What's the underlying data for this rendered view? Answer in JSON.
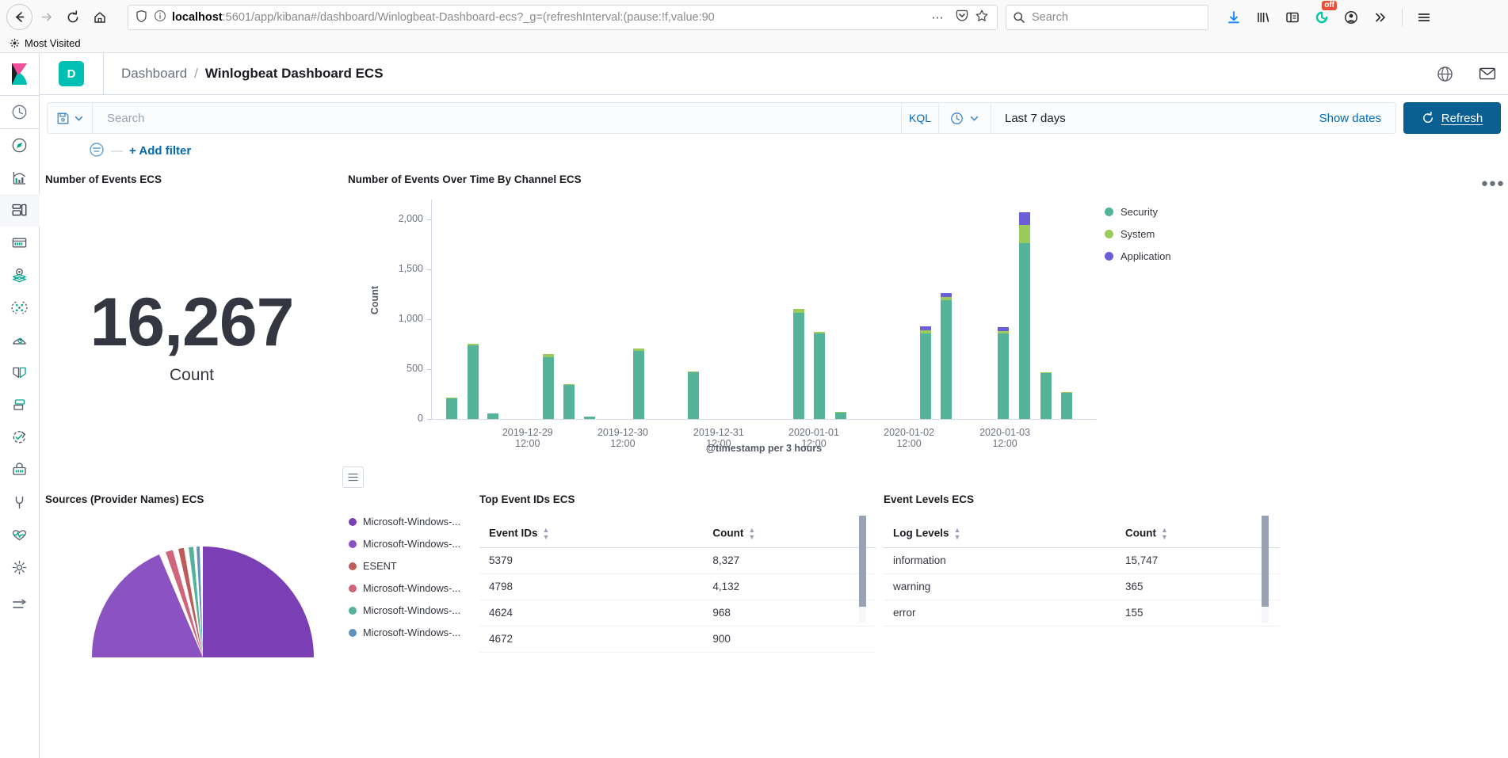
{
  "browser": {
    "url_prefix": "localhost",
    "url_rest": ":5601/app/kibana#/dashboard/Winlogbeat-Dashboard-ecs?_g=(refreshInterval:(pause:!f,value:90",
    "search_placeholder": "Search",
    "bookmark": "Most Visited",
    "icons": {
      "back": "back-arrow-icon",
      "forward": "forward-arrow-icon",
      "reload": "reload-icon",
      "home": "home-icon",
      "shield": "shield-icon",
      "info": "page-info-icon",
      "meatballs": "page-actions-icon",
      "pocket": "pocket-icon",
      "star": "bookmark-star-icon",
      "search": "search-icon",
      "download": "download-icon",
      "library": "library-icon",
      "sidebar": "sidebar-icon",
      "extension_badge": "off",
      "account": "account-icon",
      "overflow": "overflow-chevrons-icon",
      "menu": "hamburger-menu-icon"
    }
  },
  "kibana": {
    "app_badge": "D",
    "breadcrumb_parent": "Dashboard",
    "breadcrumb_separator": "/",
    "breadcrumb_current": "Winlogbeat Dashboard ECS",
    "sidebar_items": [
      {
        "name": "recently-viewed",
        "icon": "clock-icon"
      },
      {
        "name": "discover",
        "icon": "compass-icon"
      },
      {
        "name": "visualize",
        "icon": "bar-chart-icon"
      },
      {
        "name": "dashboard",
        "icon": "dashboard-icon",
        "active": true
      },
      {
        "name": "canvas",
        "icon": "canvas-icon"
      },
      {
        "name": "maps",
        "icon": "map-marker-icon"
      },
      {
        "name": "machine-learning",
        "icon": "machine-learning-icon"
      },
      {
        "name": "infrastructure",
        "icon": "infrastructure-icon"
      },
      {
        "name": "logs",
        "icon": "logs-icon"
      },
      {
        "name": "apm",
        "icon": "apm-icon"
      },
      {
        "name": "uptime",
        "icon": "uptime-icon"
      },
      {
        "name": "siem",
        "icon": "siem-icon"
      },
      {
        "name": "dev-tools",
        "icon": "wrench-icon"
      },
      {
        "name": "monitoring",
        "icon": "heartbeat-icon"
      },
      {
        "name": "management",
        "icon": "gear-icon"
      },
      {
        "name": "collapse-nav",
        "icon": "collapse-arrow-icon"
      }
    ],
    "header_icons": [
      {
        "name": "help",
        "icon": "help-globe-icon"
      },
      {
        "name": "newsfeed",
        "icon": "mail-icon"
      }
    ],
    "query": {
      "save_icon": "save-query-icon",
      "chevron_icon": "chevron-down-icon",
      "placeholder": "Search",
      "language": "KQL",
      "clock_icon": "clock-icon",
      "time_range": "Last 7 days",
      "show_dates": "Show dates",
      "refresh_icon": "refresh-icon",
      "refresh_label": "Refresh"
    },
    "filters": {
      "filter_icon": "filter-options-icon",
      "dash": "—",
      "add_filter": "+ Add filter"
    }
  },
  "panels": {
    "metric": {
      "title": "Number of Events ECS",
      "value": "16,267",
      "label": "Count"
    },
    "histogram": {
      "title": "Number of Events Over Time By Channel ECS",
      "menu_icon": "panel-menu-icon",
      "legend_toggle_icon": "legend-list-icon"
    },
    "pie": {
      "title": "Sources (Provider Names) ECS",
      "legend": [
        {
          "label": "Microsoft-Windows-...",
          "color": "#7B3FB5"
        },
        {
          "label": "Microsoft-Windows-...",
          "color": "#8B52C2"
        },
        {
          "label": "ESENT",
          "color": "#BD5B5B"
        },
        {
          "label": "Microsoft-Windows-...",
          "color": "#D0657A"
        },
        {
          "label": "Microsoft-Windows-...",
          "color": "#54B399"
        },
        {
          "label": "Microsoft-Windows-...",
          "color": "#6092C0"
        }
      ]
    },
    "event_ids": {
      "title": "Top Event IDs ECS",
      "columns": [
        "Event IDs",
        "Count"
      ],
      "rows": [
        [
          "5379",
          "8,327"
        ],
        [
          "4798",
          "4,132"
        ],
        [
          "4624",
          "968"
        ],
        [
          "4672",
          "900"
        ]
      ]
    },
    "event_levels": {
      "title": "Event Levels ECS",
      "columns": [
        "Log Levels",
        "Count"
      ],
      "rows": [
        [
          "information",
          "15,747"
        ],
        [
          "warning",
          "365"
        ],
        [
          "error",
          "155"
        ]
      ]
    }
  },
  "chart_data": {
    "type": "bar",
    "stacked": true,
    "title": "Number of Events Over Time By Channel ECS",
    "xlabel": "@timestamp per 3 hours",
    "ylabel": "Count",
    "ylim": [
      0,
      2200
    ],
    "yticks": [
      0,
      500,
      1000,
      1500,
      2000
    ],
    "ytick_labels": [
      "0",
      "500",
      "1,000",
      "1,500",
      "2,000"
    ],
    "grid": false,
    "legend_position": "right",
    "xtick_labels": [
      "2019-12-29 12:00",
      "2019-12-30 12:00",
      "2019-12-31 12:00",
      "2020-01-01 12:00",
      "2020-01-02 12:00",
      "2020-01-03 12:00"
    ],
    "xtick_positions": [
      0.145,
      0.288,
      0.432,
      0.575,
      0.718,
      0.862
    ],
    "series": [
      {
        "name": "Security",
        "color": "#54B399"
      },
      {
        "name": "System",
        "color": "#9BCB5C"
      },
      {
        "name": "Application",
        "color": "#6A5FD6"
      }
    ],
    "bars": [
      {
        "x": 0.023,
        "Security": 205,
        "System": 8,
        "Application": 0
      },
      {
        "x": 0.055,
        "Security": 735,
        "System": 18,
        "Application": 0
      },
      {
        "x": 0.085,
        "Security": 55,
        "System": 4,
        "Application": 0
      },
      {
        "x": 0.168,
        "Security": 620,
        "System": 33,
        "Application": 0
      },
      {
        "x": 0.199,
        "Security": 345,
        "System": 7,
        "Application": 0
      },
      {
        "x": 0.23,
        "Security": 22,
        "System": 5,
        "Application": 0
      },
      {
        "x": 0.303,
        "Security": 680,
        "System": 28,
        "Application": 0
      },
      {
        "x": 0.386,
        "Security": 465,
        "System": 8,
        "Application": 0
      },
      {
        "x": 0.544,
        "Security": 1062,
        "System": 45,
        "Application": 0
      },
      {
        "x": 0.575,
        "Security": 855,
        "System": 18,
        "Application": 0
      },
      {
        "x": 0.607,
        "Security": 60,
        "System": 12,
        "Application": 0
      },
      {
        "x": 0.734,
        "Security": 858,
        "System": 30,
        "Application": 42
      },
      {
        "x": 0.766,
        "Security": 1190,
        "System": 32,
        "Application": 40
      },
      {
        "x": 0.851,
        "Security": 855,
        "System": 28,
        "Application": 38
      },
      {
        "x": 0.883,
        "Security": 1760,
        "System": 185,
        "Application": 130
      },
      {
        "x": 0.915,
        "Security": 460,
        "System": 10,
        "Application": 0
      },
      {
        "x": 0.947,
        "Security": 262,
        "System": 5,
        "Application": 0
      }
    ]
  }
}
